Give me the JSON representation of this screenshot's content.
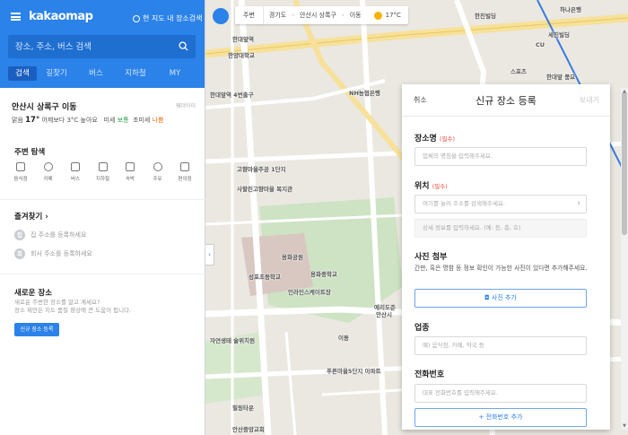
{
  "app": {
    "logo": "kakaomap",
    "map_search_toggle": "현 지도 내 장소검색"
  },
  "search": {
    "placeholder": "장소, 주소, 버스 검색"
  },
  "tabs": [
    {
      "label": "검색",
      "active": true
    },
    {
      "label": "길찾기"
    },
    {
      "label": "버스"
    },
    {
      "label": "지하철"
    },
    {
      "label": "MY"
    }
  ],
  "weather": {
    "location": "안산시 상록구 이동",
    "source": "웨더아이",
    "condition": "맑음",
    "temp": "17°",
    "desc": "어제보다 3°C 높아요",
    "fine_dust_label": "미세",
    "fine_dust_value": "보통",
    "ultrafine_label": "초미세",
    "ultrafine_value": "나쁨"
  },
  "nearby": {
    "title": "주변 탐색",
    "items": [
      {
        "label": "음식점",
        "icon": "fork-knife-icon"
      },
      {
        "label": "카페",
        "icon": "cup-icon"
      },
      {
        "label": "버스",
        "icon": "bus-icon"
      },
      {
        "label": "지하철",
        "icon": "subway-icon"
      },
      {
        "label": "숙박",
        "icon": "bed-icon"
      },
      {
        "label": "주유",
        "icon": "fuel-icon"
      },
      {
        "label": "편의점",
        "icon": "store-icon"
      }
    ]
  },
  "favorites": {
    "title": "즐겨찾기 ›",
    "home": {
      "badge": "집",
      "label": "집 주소를 등록하세요"
    },
    "work": {
      "badge": "회",
      "label": "회사 주소를 등록하세요"
    }
  },
  "new_place": {
    "title": "새로운 장소",
    "desc1": "새로운 주변한 장소를 알고 계세요?",
    "desc2": "장소 제안은 지도 품질 향상에 큰 도움이 됩니다.",
    "button": "신규 장소 등록"
  },
  "map_topbar": {
    "nearby_btn": "주변",
    "crumbs": [
      "경기도",
      "안산시 상록구",
      "이동"
    ],
    "temp": "17°C"
  },
  "map_labels": [
    "한대앞역",
    "한양대학교",
    "한대앞역 4번출구",
    "NH농협은행",
    "성포초등학교",
    "용화공원",
    "용화중학교",
    "인라인스케이트장",
    "고향마을주공 1단지",
    "사할린고향마을 복지관",
    "자연생태 술위치원",
    "힐링타운",
    "안산중앙교회",
    "푸른마을5단지 아파트",
    "이동",
    "안산시",
    "에리도준",
    "하나은행",
    "세진빌딩",
    "CU",
    "스포츠",
    "한진빌딩",
    "한대앞 풍요"
  ],
  "dialog": {
    "cancel": "취소",
    "title": "신규 장소 등록",
    "send": "보내기",
    "name_label": "장소명",
    "required": "(필수)",
    "name_placeholder": "업체의 명칭을 입력해주세요.",
    "loc_label": "위치",
    "loc_placeholder": "여기를 눌러 주소를 검색해주세요.",
    "loc_detail_placeholder": "상세 정보를 입력하세요. (예: 동, 층, 호)",
    "photo_label": "사진 첨부",
    "photo_desc": "간판, 혹은 명함 등 정보 확인이 가능한 사진이 있다면 추가해주세요.",
    "photo_btn": "사진 추가",
    "biz_label": "업종",
    "biz_placeholder": "예) 음식점, 카페, 약국 등",
    "phone_label": "전화번호",
    "phone_placeholder": "대표 전화번호를 입력해주세요.",
    "phone_btn": "+ 전화번호 추가"
  }
}
